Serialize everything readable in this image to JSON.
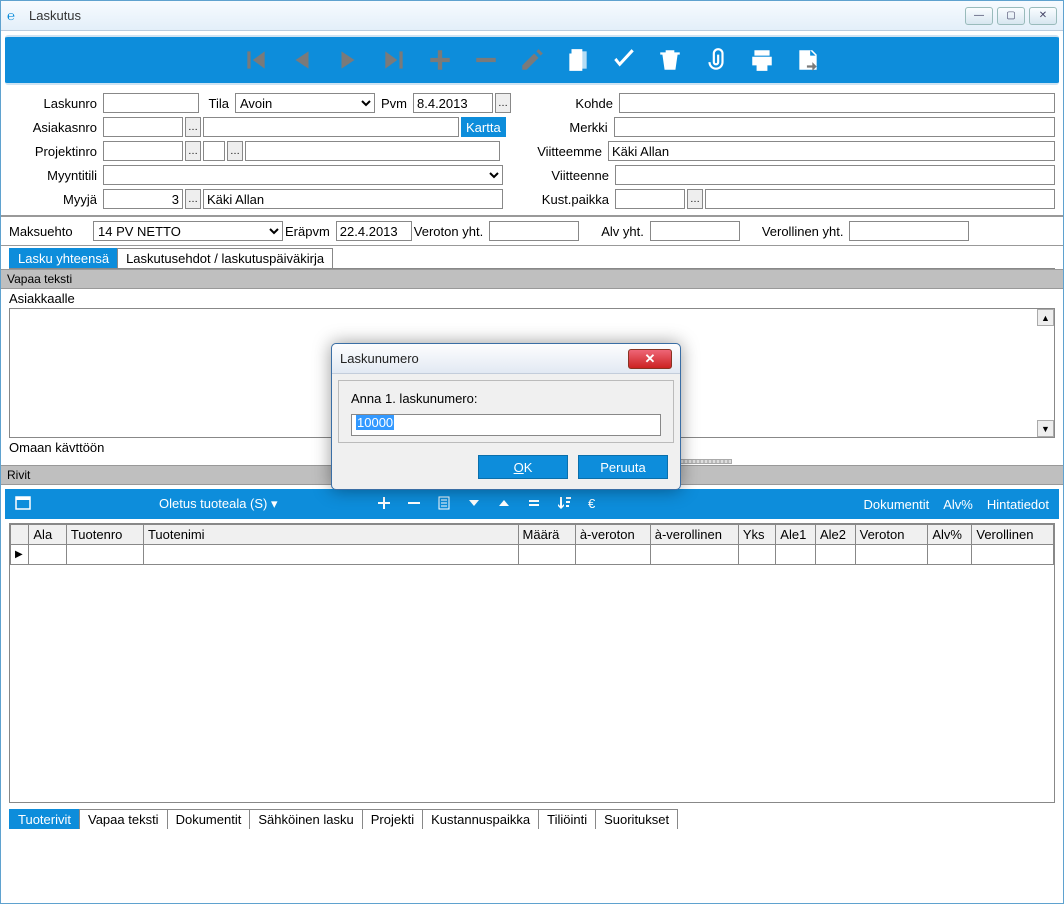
{
  "window": {
    "title": "Laskutus"
  },
  "form": {
    "labels": {
      "laskunro": "Laskunro",
      "tila": "Tila",
      "pvm": "Pvm",
      "asiakasnro": "Asiakasnro",
      "projektinro": "Projektinro",
      "myyntitili": "Myyntitili",
      "myyja": "Myyjä",
      "kohde": "Kohde",
      "merkki": "Merkki",
      "viitteemme": "Viitteemme",
      "viitteenne": "Viitteenne",
      "kustpaikka": "Kust.paikka",
      "maksuehto": "Maksuehto",
      "erapvm": "Eräpvm",
      "veroton_yht": "Veroton yht.",
      "alv_yht": "Alv yht.",
      "verollinen_yht": "Verollinen yht."
    },
    "values": {
      "laskunro": "",
      "tila": "Avoin",
      "pvm": "8.4.2013",
      "asiakasnro": "",
      "asiakasnimi": "",
      "kartta": "Kartta",
      "projektinro": "",
      "projektinro2": "",
      "projektinimi": "",
      "myyntitili": "",
      "myyja_nro": "3",
      "myyja_nimi": "Käki Allan",
      "kohde": "",
      "merkki": "",
      "viitteemme": "Käki Allan",
      "viitteenne": "",
      "kustpaikka": "",
      "kustpaikka_nimi": "",
      "maksuehto": "14 PV NETTO",
      "erapvm": "22.4.2013",
      "veroton_yht": "",
      "alv_yht": "",
      "verollinen_yht": ""
    }
  },
  "tabs_upper": {
    "t1": "Lasku yhteensä",
    "t2": "Laskutusehdot / laskutuspäiväkirja"
  },
  "sections": {
    "vapaa_teksti": "Vapaa teksti",
    "asiakkaalle": "Asiakkaalle",
    "omaan": "Omaan kävttöön",
    "rivit": "Rivit"
  },
  "rows_toolbar": {
    "oletus": "Oletus tuoteala (S)",
    "dokumentit": "Dokumentit",
    "alv": "Alv%",
    "hintatiedot": "Hintatiedot"
  },
  "grid": {
    "headers": [
      "",
      "Ala",
      "Tuotenro",
      "Tuotenimi",
      "Määrä",
      "à-veroton",
      "à-verollinen",
      "Yks",
      "Ale1",
      "Ale2",
      "Veroton",
      "Alv%",
      "Verollinen"
    ],
    "rows": [
      [
        "",
        "",
        "",
        "",
        "",
        "",
        "",
        "",
        "",
        "",
        "",
        "",
        ""
      ]
    ]
  },
  "tabs_lower": {
    "t1": "Tuoterivit",
    "t2": "Vapaa teksti",
    "t3": "Dokumentit",
    "t4": "Sähköinen lasku",
    "t5": "Projekti",
    "t6": "Kustannuspaikka",
    "t7": "Tiliöinti",
    "t8": "Suoritukset"
  },
  "dialog": {
    "title": "Laskunumero",
    "prompt": "Anna 1. laskunumero:",
    "value": "10000",
    "ok": "OK",
    "cancel": "Peruuta"
  }
}
